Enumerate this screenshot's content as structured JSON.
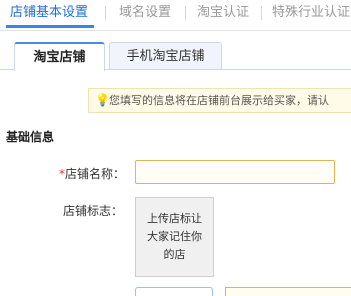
{
  "top_nav": {
    "tabs": [
      {
        "label": "店铺基本设置",
        "active": true
      },
      {
        "label": "域名设置",
        "active": false
      },
      {
        "label": "淘宝认证",
        "active": false
      },
      {
        "label": "特殊行业认证",
        "active": false
      }
    ]
  },
  "sub_tabs": {
    "taobao_shop": "淘宝店铺",
    "mobile_taobao_shop": "手机淘宝店铺"
  },
  "tip": {
    "icon": "lightbulb-icon",
    "text": "您填写的信息将在店铺前台展示给买家，请认"
  },
  "section": {
    "title": "基础信息"
  },
  "form": {
    "shop_name": {
      "required_mark": "*",
      "label": "店铺名称：",
      "value": ""
    },
    "shop_logo": {
      "label": "店铺标志：",
      "upload_text": "上传店标让大家记住你的店"
    }
  },
  "colors": {
    "accent": "#1f6fd8",
    "required": "#e4393c",
    "input_border": "#e0b25a"
  }
}
